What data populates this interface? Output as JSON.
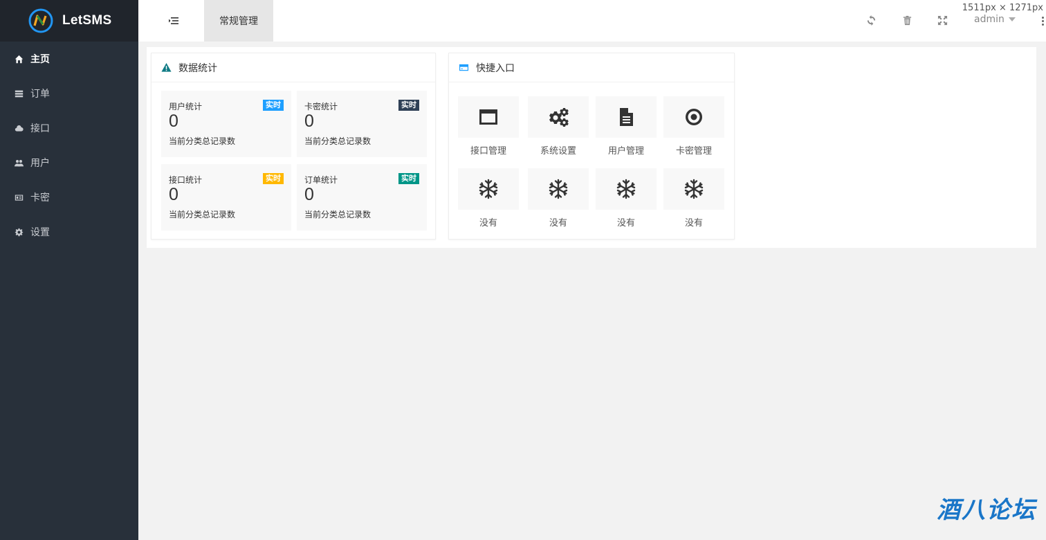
{
  "app": {
    "name": "LetSMS"
  },
  "sidebar": {
    "items": [
      {
        "label": "主页",
        "icon": "home-icon",
        "active": true
      },
      {
        "label": "订单",
        "icon": "list-icon",
        "active": false
      },
      {
        "label": "接口",
        "icon": "cloud-icon",
        "active": false
      },
      {
        "label": "用户",
        "icon": "users-icon",
        "active": false
      },
      {
        "label": "卡密",
        "icon": "id-card-icon",
        "active": false
      },
      {
        "label": "设置",
        "icon": "gear-icon",
        "active": false
      }
    ]
  },
  "header": {
    "tab_label": "常规管理",
    "user": "admin",
    "dimension_overlay": "1511px × 1271px"
  },
  "stats_card": {
    "title": "数据统计",
    "stats": [
      {
        "title": "用户统计",
        "badge": "实时",
        "badge_color": "#1e9fff",
        "value": "0",
        "desc": "当前分类总记录数"
      },
      {
        "title": "卡密统计",
        "badge": "实时",
        "badge_color": "#2f4056",
        "value": "0",
        "desc": "当前分类总记录数"
      },
      {
        "title": "接口统计",
        "badge": "实时",
        "badge_color": "#ffb800",
        "value": "0",
        "desc": "当前分类总记录数"
      },
      {
        "title": "订单统计",
        "badge": "实时",
        "badge_color": "#009688",
        "value": "0",
        "desc": "当前分类总记录数"
      }
    ]
  },
  "quick_card": {
    "title": "快捷入口",
    "items": [
      {
        "label": "接口管理",
        "icon": "window-icon"
      },
      {
        "label": "系统设置",
        "icon": "gears-icon"
      },
      {
        "label": "用户管理",
        "icon": "file-icon"
      },
      {
        "label": "卡密管理",
        "icon": "target-icon"
      },
      {
        "label": "没有",
        "icon": "snowflake-icon"
      },
      {
        "label": "没有",
        "icon": "snowflake-icon"
      },
      {
        "label": "没有",
        "icon": "snowflake-icon"
      },
      {
        "label": "没有",
        "icon": "snowflake-icon"
      }
    ]
  },
  "watermark": {
    "text": "酒八论坛"
  },
  "colors": {
    "sidebar_bg": "#28303a",
    "logo_bg": "#20252c",
    "accent": "#009688"
  }
}
